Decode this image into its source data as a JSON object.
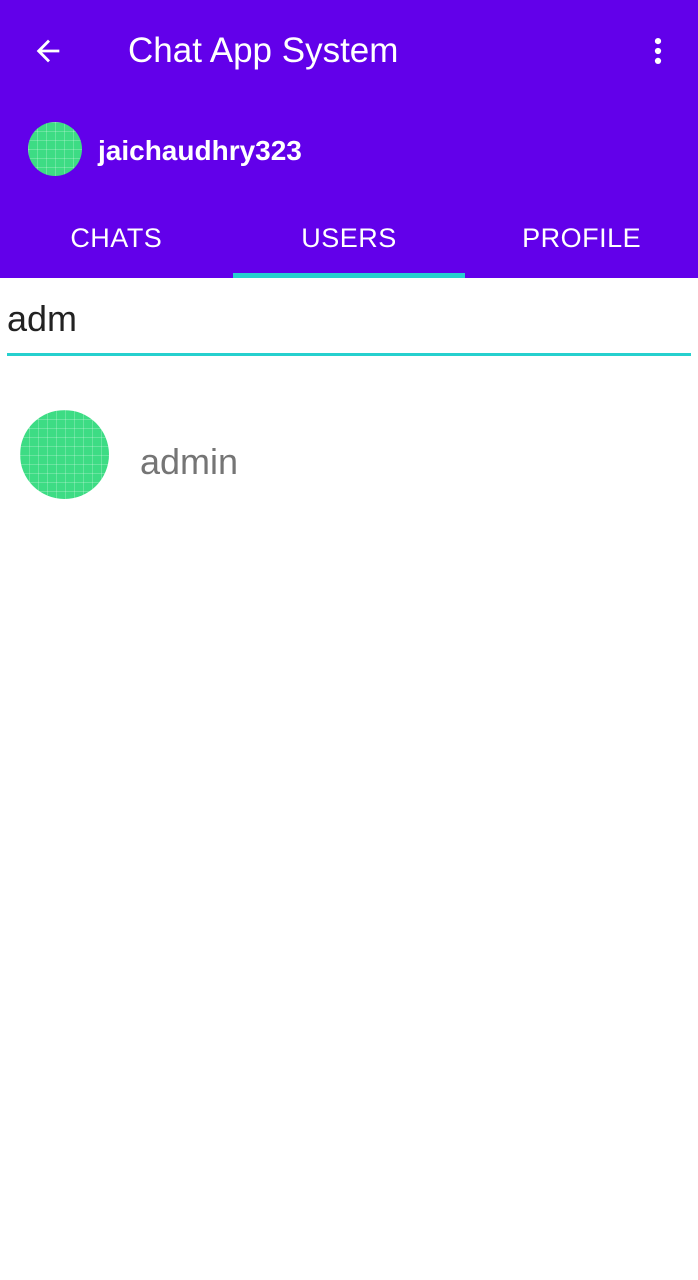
{
  "app": {
    "title": "Chat App System",
    "icons": {
      "back": "arrow-left-icon",
      "menu": "more-vertical-icon"
    },
    "colors": {
      "primary": "#6200ea",
      "accent": "#26d0ce",
      "avatar": "#3ddc84"
    }
  },
  "current_user": {
    "username": "jaichaudhry323"
  },
  "tabs": [
    {
      "label": "CHATS",
      "active": false
    },
    {
      "label": "USERS",
      "active": true
    },
    {
      "label": "PROFILE",
      "active": false
    }
  ],
  "search": {
    "value": "adm"
  },
  "users": [
    {
      "name": "admin"
    }
  ]
}
